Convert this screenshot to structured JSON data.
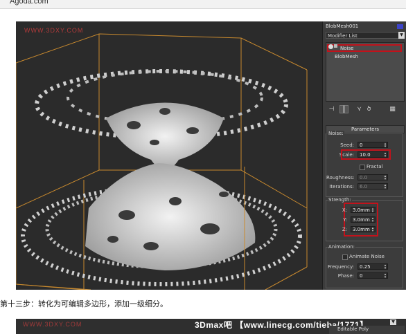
{
  "browser": {
    "site": "Agoda.com"
  },
  "viewport": {
    "watermark": "WWW.3DXY.COM"
  },
  "panel": {
    "object_name": "BlobMesh001",
    "modifier_list": "Modifier List",
    "stack": [
      "Noise",
      "BlobMesh"
    ],
    "parameters_title": "Parameters",
    "noise": {
      "title": "Noise:",
      "seed_label": "Seed:",
      "seed": "0",
      "scale_label": "Scale:",
      "scale": "10.0",
      "fractal_label": "Fractal",
      "roughness_label": "Roughness:",
      "roughness": "0.0",
      "iterations_label": "Iterations:",
      "iterations": "6.0"
    },
    "strength": {
      "title": "Strength:",
      "x_label": "X:",
      "x": "3.0mm",
      "y_label": "Y:",
      "y": "3.0mm",
      "z_label": "Z:",
      "z": "3.0mm"
    },
    "animation": {
      "title": "Animation:",
      "animate_label": "Animate Noise",
      "frequency_label": "Frequency:",
      "frequency": "0.25",
      "phase_label": "Phase:",
      "phase": "0"
    }
  },
  "caption": "第十三步：转化为可编辑多边形，添加一级细分。",
  "second_shot": {
    "watermark": "3Dmax吧 【www.linecg.com/tieba/1771】",
    "watermark_small": "WWW.3DXY.COM",
    "stack_item": "Editable Poly"
  },
  "colors": {
    "highlight": "#c2121b",
    "object_color": "#3d44c9",
    "box_line": "#c98a2e"
  }
}
